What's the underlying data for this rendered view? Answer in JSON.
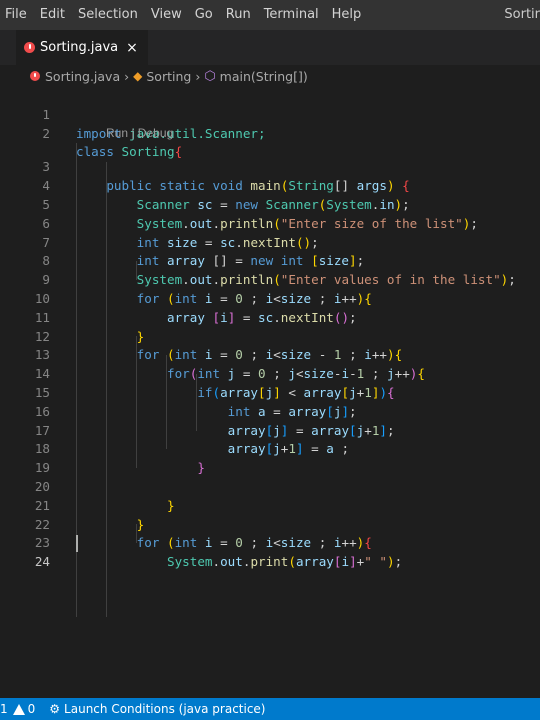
{
  "menu": [
    "File",
    "Edit",
    "Selection",
    "View",
    "Go",
    "Run",
    "Terminal",
    "Help"
  ],
  "window_title": "Sortir",
  "tab": {
    "label": "Sorting.java",
    "close": "×"
  },
  "breadcrumb": {
    "file": "Sorting.java",
    "cls": "Sorting",
    "method": "main(String[])"
  },
  "codelens": "Run | Debug",
  "line_numbers": [
    "1",
    "2",
    "3",
    "4",
    "5",
    "6",
    "7",
    "8",
    "9",
    "10",
    "11",
    "12",
    "13",
    "14",
    "15",
    "16",
    "17",
    "18",
    "19",
    "20",
    "21",
    "22",
    "23",
    "24"
  ],
  "code": {
    "l1_import": "import",
    "l1_pkg": " java.util.Scanner;",
    "l2_class": "class",
    "l2_name": "Sorting",
    "l2_brace": "{",
    "l3_mods": "public static void",
    "l3_main": "main",
    "l3_p1": "(",
    "l3_string": "String",
    "l3_arr": "[] ",
    "l3_args": "args",
    "l3_p2": ")",
    "l3_brace": "{",
    "l4_type": "Scanner",
    "l4_var": " sc",
    "l4_eq": " = ",
    "l4_new": "new",
    "l4_ctor": " Scanner",
    "l4_p1": "(",
    "l4_sys": "System",
    "l4_dot": ".",
    "l4_in": "in",
    "l4_p2": ")",
    "l4_semi": ";",
    "l5_sys": "System",
    "l5_dot1": ".",
    "l5_out": "out",
    "l5_dot2": ".",
    "l5_fn": "println",
    "l5_p1": "(",
    "l5_str": "\"Enter size of the list\"",
    "l5_p2": ")",
    "l5_semi": ";",
    "l6_int": "int",
    "l6_var": " size",
    "l6_eq": " = ",
    "l6_sc": "sc",
    "l6_dot": ".",
    "l6_fn": "nextInt",
    "l6_p": "()",
    "l6_semi": ";",
    "l7_int": "int",
    "l7_var": " array",
    "l7_br": " [] = ",
    "l7_new": "new",
    "l7_int2": " int",
    "l7_b1": " [",
    "l7_size": "size",
    "l7_b2": "]",
    "l7_semi": ";",
    "l8_sys": "System",
    "l8_dot1": ".",
    "l8_out": "out",
    "l8_dot2": ".",
    "l8_fn": "println",
    "l8_p1": "(",
    "l8_str": "\"Enter values of in the list\"",
    "l8_p2": ")",
    "l8_semi": ";",
    "l9_for": "for",
    "l9_p1": " (",
    "l9_int": "int",
    "l9_i": " i",
    "l9_eq": " = ",
    "l9_zero": "0",
    "l9_semi1": " ; ",
    "l9_i2": "i",
    "l9_lt": "<",
    "l9_size": "size",
    "l9_semi2": " ; ",
    "l9_i3": "i",
    "l9_inc": "++",
    "l9_p2": ")",
    "l9_brace": "{",
    "l10_arr": "array",
    "l10_b1": " [",
    "l10_i": "i",
    "l10_b2": "]",
    "l10_eq": " = ",
    "l10_sc": "sc",
    "l10_dot": ".",
    "l10_fn": "nextInt",
    "l10_p": "()",
    "l10_semi": ";",
    "l11_brace": "}",
    "l12_for": "for",
    "l12_p1": " (",
    "l12_int": "int",
    "l12_i": " i",
    "l12_eq": " = ",
    "l12_zero": "0",
    "l12_semi1": " ; ",
    "l12_i2": "i",
    "l12_lt": "<",
    "l12_size": "size",
    "l12_minus": " - ",
    "l12_one": "1",
    "l12_semi2": " ; ",
    "l12_i3": "i",
    "l12_inc": "++",
    "l12_p2": ")",
    "l12_brace": "{",
    "l13_for": "for",
    "l13_p1": "(",
    "l13_int": "int",
    "l13_j": " j",
    "l13_eq": " = ",
    "l13_zero": "0",
    "l13_semi1": " ; ",
    "l13_j2": "j",
    "l13_lt": "<",
    "l13_size": "size",
    "l13_m1": "-",
    "l13_i": "i",
    "l13_m2": "-",
    "l13_one": "1",
    "l13_semi2": " ; ",
    "l13_j3": "j",
    "l13_inc": "++",
    "l13_p2": ")",
    "l13_brace": "{",
    "l14_if": "if",
    "l14_p1": "(",
    "l14_arr": "array",
    "l14_b1": "[",
    "l14_j": "j",
    "l14_b2": "]",
    "l14_lt": " < ",
    "l14_arr2": "array",
    "l14_b3": "[",
    "l14_j2": "j",
    "l14_plus": "+",
    "l14_one": "1",
    "l14_b4": "]",
    "l14_p2": ")",
    "l14_brace": "{",
    "l15_int": "int",
    "l15_a": " a",
    "l15_eq": " = ",
    "l15_arr": "array",
    "l15_b1": "[",
    "l15_j": "j",
    "l15_b2": "]",
    "l15_semi": ";",
    "l16_arr": "array",
    "l16_b1": "[",
    "l16_j": "j",
    "l16_b2": "]",
    "l16_eq": " = ",
    "l16_arr2": "array",
    "l16_b3": "[",
    "l16_j2": "j",
    "l16_plus": "+",
    "l16_one": "1",
    "l16_b4": "]",
    "l16_semi": ";",
    "l17_arr": "array",
    "l17_b1": "[",
    "l17_j": "j",
    "l17_plus": "+",
    "l17_one": "1",
    "l17_b2": "]",
    "l17_eq": " = ",
    "l17_a": "a",
    "l17_semi": " ;",
    "l18_brace": "}",
    "l20_brace": "}",
    "l21_brace": "}",
    "l22_for": "for",
    "l22_p1": " (",
    "l22_int": "int",
    "l22_i": " i",
    "l22_eq": " = ",
    "l22_zero": "0",
    "l22_semi1": " ; ",
    "l22_i2": "i",
    "l22_lt": "<",
    "l22_size": "size",
    "l22_semi2": " ; ",
    "l22_i3": "i",
    "l22_inc": "++",
    "l22_p2": ")",
    "l22_brace": "{",
    "l23_sys": "System",
    "l23_dot1": ".",
    "l23_out": "out",
    "l23_dot2": ".",
    "l23_fn": "print",
    "l23_p1": "(",
    "l23_arr": "array",
    "l23_b1": "[",
    "l23_i": "i",
    "l23_b2": "]",
    "l23_plus": "+",
    "l23_str": "\" \"",
    "l23_p2": ")",
    "l23_semi": ";"
  },
  "status": {
    "errors": "1",
    "warnings": "0",
    "launch": "Launch Conditions (java practice)"
  },
  "colors": {
    "accent": "#007acc",
    "background": "#1e1e1e",
    "error": "#f14c4c"
  }
}
